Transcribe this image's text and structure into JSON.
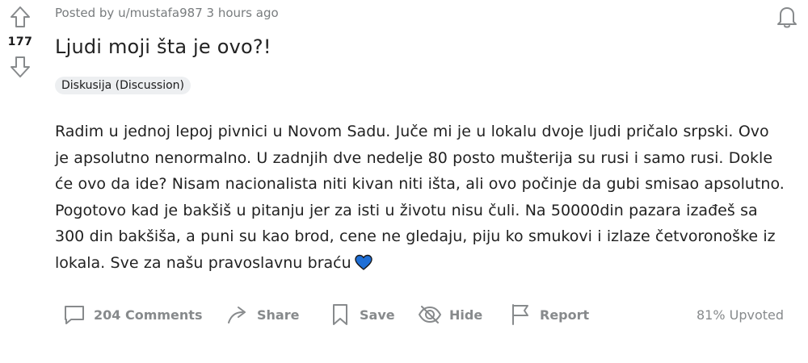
{
  "post": {
    "score": "177",
    "meta": "Posted by u/mustafa987 3 hours ago",
    "title": "Ljudi moji šta je ovo?!",
    "flair": "Diskusija (Discussion)",
    "body": "Radim u jednoj lepoj pivnici u Novom Sadu. Juče mi je u lokalu dvoje ljudi pričalo srpski. Ovo je apsolutno nenormalno. U zadnjih dve nedelje 80 posto mušterija su rusi i samo rusi. Dokle će ovo da ide? Nisam nacionalista niti kivan niti išta, ali ovo počinje da gubi smisao apsolutno. Pogotovo kad je bakšiš u pitanju jer za isti u životu nisu čuli. Na 50000din pazara izađeš sa 300 din bakšiša, a puni su kao brod, cene ne gledaju, piju ko smukovi i izlaze četvoronoške iz lokala. Sve za našu pravoslavnu braću",
    "body_emoji": "blue-heart-icon"
  },
  "actions": {
    "comments_label": "204 Comments",
    "share_label": "Share",
    "save_label": "Save",
    "hide_label": "Hide",
    "report_label": "Report",
    "upvoted_label": "81% Upvoted"
  },
  "icons": [
    "upvote-icon",
    "downvote-icon",
    "bell-icon",
    "comment-icon",
    "share-icon",
    "save-icon",
    "hide-icon",
    "report-icon",
    "blue-heart-icon"
  ],
  "colors": {
    "muted": "#878a8c",
    "meta": "#787c7e",
    "flair_bg": "#edeff1",
    "heart": "#1f6fd6",
    "text": "#222222"
  }
}
